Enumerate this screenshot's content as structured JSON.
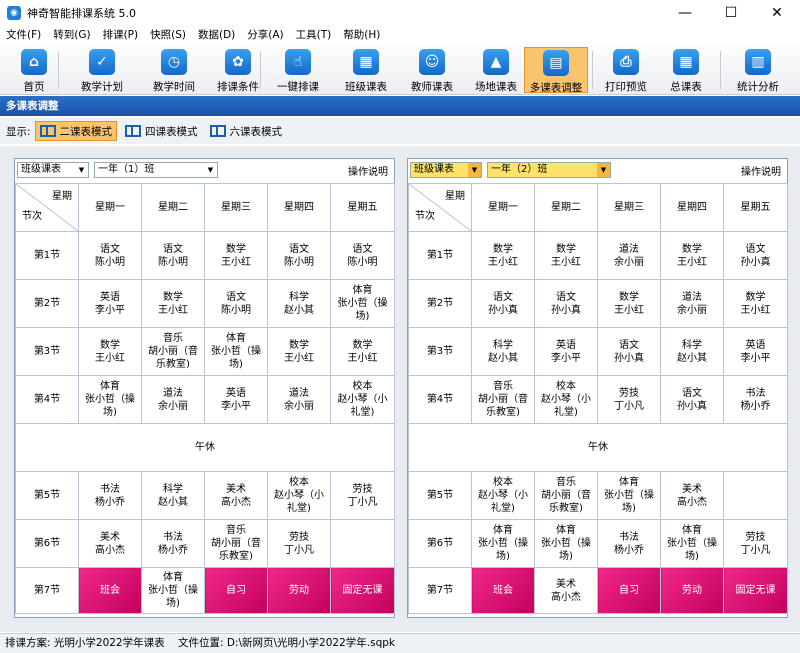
{
  "window": {
    "title": "神奇智能排课系统 5.0",
    "minimize": "—",
    "maximize": "☐",
    "close": "✕"
  },
  "menu": [
    "文件(F)",
    "转到(G)",
    "排课(P)",
    "快照(S)",
    "数据(D)",
    "分享(A)",
    "工具(T)",
    "帮助(H)"
  ],
  "toolbar": [
    {
      "label": "首页",
      "icon": "home-icon",
      "glyph": "⌂",
      "active": false
    },
    {
      "label": "教学计划",
      "icon": "clipboard-icon",
      "glyph": "✓",
      "active": false
    },
    {
      "label": "教学时间",
      "icon": "clock-icon",
      "glyph": "◷",
      "active": false
    },
    {
      "label": "排课条件",
      "icon": "conditions-icon",
      "glyph": "✿",
      "active": false
    },
    {
      "label": "一键排课",
      "icon": "hand-pointer-icon",
      "glyph": "☝",
      "active": false
    },
    {
      "label": "班级课表",
      "icon": "calendar-icon",
      "glyph": "▦",
      "active": false
    },
    {
      "label": "教师课表",
      "icon": "teacher-icon",
      "glyph": "☺",
      "active": false
    },
    {
      "label": "场地课表",
      "icon": "venue-icon",
      "glyph": "▲",
      "active": false
    },
    {
      "label": "多课表调整",
      "icon": "multi-schedule-icon",
      "glyph": "▤",
      "active": true
    },
    {
      "label": "打印预览",
      "icon": "printer-icon",
      "glyph": "⎙",
      "active": false
    },
    {
      "label": "总课表",
      "icon": "master-schedule-icon",
      "glyph": "▦",
      "active": false
    },
    {
      "label": "统计分析",
      "icon": "chart-icon",
      "glyph": "▥",
      "active": false
    }
  ],
  "section_title": "多课表调整",
  "display": {
    "label": "显示:",
    "modes": [
      {
        "label": "二课表模式",
        "active": true
      },
      {
        "label": "四课表模式",
        "active": false
      },
      {
        "label": "六课表模式",
        "active": false
      }
    ]
  },
  "days": [
    "星期一",
    "星期二",
    "星期三",
    "星期四",
    "星期五"
  ],
  "corner": {
    "day": "星期",
    "slot": "节次"
  },
  "lunch_label": "午休",
  "period_labels": [
    "第1节",
    "第2节",
    "第3节",
    "第4节",
    "第5节",
    "第6节",
    "第7节"
  ],
  "panels": [
    {
      "type_select": "班级课表",
      "class_select": "一年（1）班",
      "help": "操作说明",
      "rows": [
        [
          [
            "语文",
            "陈小明"
          ],
          [
            "语文",
            "陈小明"
          ],
          [
            "数学",
            "王小红"
          ],
          [
            "语文",
            "陈小明"
          ],
          [
            "语文",
            "陈小明"
          ]
        ],
        [
          [
            "英语",
            "李小平"
          ],
          [
            "数学",
            "王小红"
          ],
          [
            "语文",
            "陈小明"
          ],
          [
            "科学",
            "赵小其"
          ],
          [
            "体育",
            "张小哲（操",
            "场)"
          ]
        ],
        [
          [
            "数学",
            "王小红"
          ],
          [
            "音乐",
            "胡小丽（音",
            "乐教室)"
          ],
          [
            "体育",
            "张小哲（操",
            "场)"
          ],
          [
            "数学",
            "王小红"
          ],
          [
            "数学",
            "王小红"
          ]
        ],
        [
          [
            "体育",
            "张小哲（操",
            "场)"
          ],
          [
            "道法",
            "余小丽"
          ],
          [
            "英语",
            "李小平"
          ],
          [
            "道法",
            "余小丽"
          ],
          [
            "校本",
            "赵小琴（小",
            "礼堂)"
          ]
        ],
        [
          [
            "书法",
            "杨小乔"
          ],
          [
            "科学",
            "赵小其"
          ],
          [
            "美术",
            "高小杰"
          ],
          [
            "校本",
            "赵小琴（小",
            "礼堂)"
          ],
          [
            "劳技",
            "丁小凡"
          ]
        ],
        [
          [
            "美术",
            "高小杰"
          ],
          [
            "书法",
            "杨小乔"
          ],
          [
            "音乐",
            "胡小丽（音",
            "乐教室)"
          ],
          [
            "劳技",
            "丁小凡"
          ],
          []
        ],
        [
          [
            "班会"
          ],
          [
            "体育",
            "张小哲（操场)"
          ],
          [
            "自习"
          ],
          [
            "劳动"
          ],
          [
            "固定无课"
          ]
        ]
      ],
      "pink": [
        [
          6,
          0
        ],
        [
          6,
          2
        ],
        [
          6,
          3
        ],
        [
          6,
          4
        ]
      ]
    },
    {
      "type_select": "班级课表",
      "class_select": "一年（2）班",
      "help": "操作说明",
      "rows": [
        [
          [
            "数学",
            "王小红"
          ],
          [
            "数学",
            "王小红"
          ],
          [
            "道法",
            "余小丽"
          ],
          [
            "数学",
            "王小红"
          ],
          [
            "语文",
            "孙小真"
          ]
        ],
        [
          [
            "语文",
            "孙小真"
          ],
          [
            "语文",
            "孙小真"
          ],
          [
            "数学",
            "王小红"
          ],
          [
            "道法",
            "余小丽"
          ],
          [
            "数学",
            "王小红"
          ]
        ],
        [
          [
            "科学",
            "赵小其"
          ],
          [
            "英语",
            "李小平"
          ],
          [
            "语文",
            "孙小真"
          ],
          [
            "科学",
            "赵小其"
          ],
          [
            "英语",
            "李小平"
          ]
        ],
        [
          [
            "音乐",
            "胡小丽（音",
            "乐教室)"
          ],
          [
            "校本",
            "赵小琴（小",
            "礼堂)"
          ],
          [
            "劳技",
            "丁小凡"
          ],
          [
            "语文",
            "孙小真"
          ],
          [
            "书法",
            "杨小乔"
          ]
        ],
        [
          [
            "校本",
            "赵小琴（小",
            "礼堂)"
          ],
          [
            "音乐",
            "胡小丽（音",
            "乐教室)"
          ],
          [
            "体育",
            "张小哲（操",
            "场)"
          ],
          [
            "美术",
            "高小杰"
          ],
          []
        ],
        [
          [
            "体育",
            "张小哲（操",
            "场)"
          ],
          [
            "体育",
            "张小哲（操",
            "场)"
          ],
          [
            "书法",
            "杨小乔"
          ],
          [
            "体育",
            "张小哲（操",
            "场)"
          ],
          [
            "劳技",
            "丁小凡"
          ]
        ],
        [
          [
            "班会"
          ],
          [
            "美术",
            "高小杰"
          ],
          [
            "自习"
          ],
          [
            "劳动"
          ],
          [
            "固定无课"
          ]
        ]
      ],
      "pink": [
        [
          6,
          0
        ],
        [
          6,
          2
        ],
        [
          6,
          3
        ],
        [
          6,
          4
        ]
      ]
    }
  ],
  "status": {
    "scheme_label": "排课方案:",
    "scheme_value": "光明小学2022学年课表",
    "file_label": "文件位置:",
    "file_value": "D:\\新网页\\光明小学2022学年.sqpk"
  }
}
